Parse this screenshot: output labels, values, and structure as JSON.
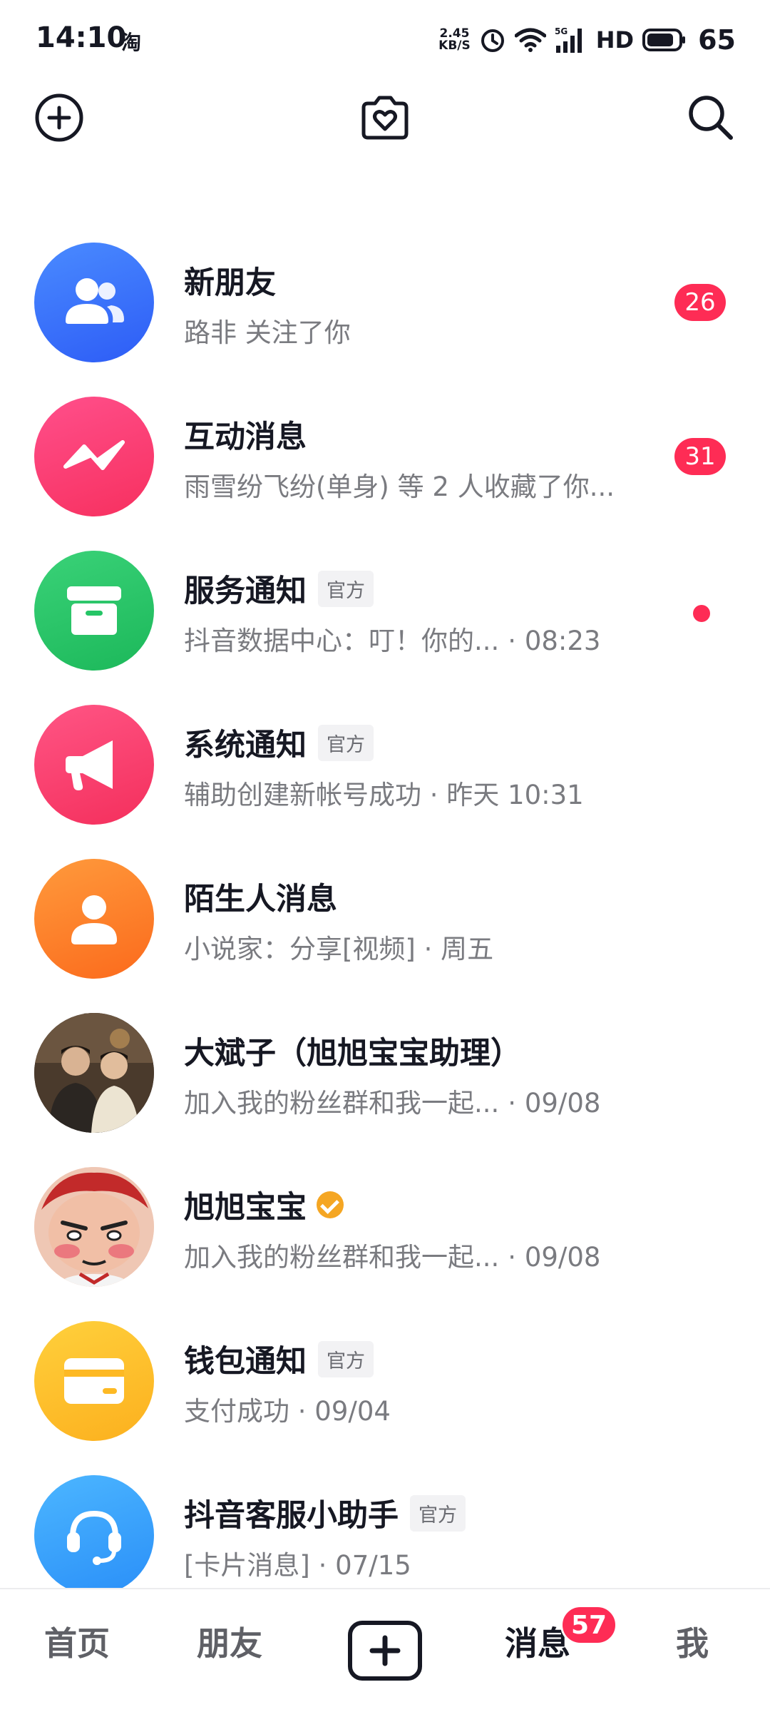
{
  "status_bar": {
    "time": "14:10",
    "app_icon_label": "淘",
    "net_speed_value": "2.45",
    "net_speed_unit": "KB/S",
    "signal_label": "5G",
    "hd_label": "HD",
    "battery_level": "65"
  },
  "top_bar": {
    "left_icon": "plus-circle-icon",
    "center_icon": "camera-heart-icon",
    "right_icon": "search-icon"
  },
  "messages": [
    {
      "title": "新朋友",
      "subtitle": "路非 关注了你",
      "badge": "26",
      "avatar_icon": "people-icon",
      "avatar_color": "#3a7bfd"
    },
    {
      "title": "互动消息",
      "subtitle": "雨雪纷飞纷(单身) 等 2 人收藏了你...",
      "badge": "31",
      "avatar_icon": "zigzag-icon",
      "avatar_color": "#fb3f7a"
    },
    {
      "title": "服务通知",
      "tag": "官方",
      "subtitle": "抖音数据中心：叮！你的...",
      "time": "· 08:23",
      "unread_dot": true,
      "avatar_icon": "box-icon",
      "avatar_color": "#25c566"
    },
    {
      "title": "系统通知",
      "tag": "官方",
      "subtitle": "辅助创建新帐号成功 · 昨天 10:31",
      "avatar_icon": "megaphone-icon",
      "avatar_color": "#fb3f6e"
    },
    {
      "title": "陌生人消息",
      "subtitle": "小说家：分享[视频] · 周五",
      "avatar_icon": "person-icon",
      "avatar_color": "#fd7f2c"
    },
    {
      "title": "大斌子（旭旭宝宝助理）",
      "subtitle": "加入我的粉丝群和我一起...",
      "time": "· 09/08",
      "avatar_icon": "photo-avatar"
    },
    {
      "title": "旭旭宝宝",
      "verified": true,
      "subtitle": "加入我的粉丝群和我一起...",
      "time": "· 09/08",
      "avatar_icon": "cartoon-avatar"
    },
    {
      "title": "钱包通知",
      "tag": "官方",
      "subtitle": "支付成功 · 09/04",
      "avatar_icon": "card-icon",
      "avatar_color": "#fdb924"
    },
    {
      "title": "抖音客服小助手",
      "tag": "官方",
      "subtitle": "[卡片消息] · 07/15",
      "avatar_icon": "headset-icon",
      "avatar_color": "#34a2fb"
    }
  ],
  "bottom_nav": {
    "home": "首页",
    "friends": "朋友",
    "messages": "消息",
    "messages_badge": "57",
    "me": "我"
  }
}
